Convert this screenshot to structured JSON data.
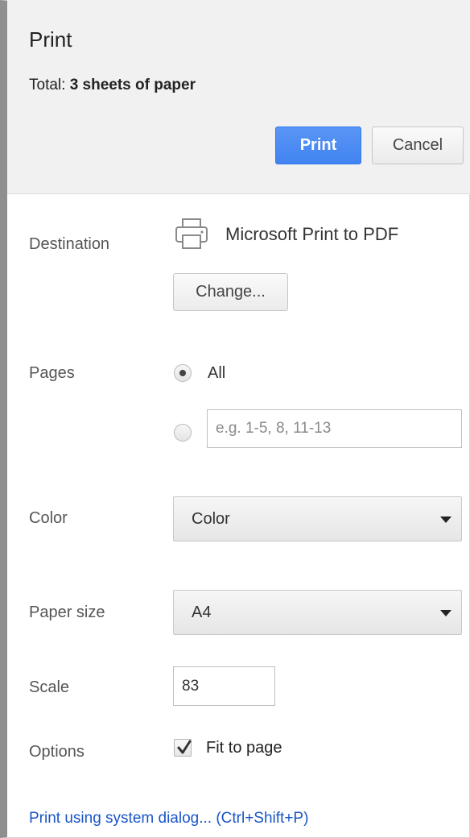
{
  "header": {
    "title": "Print",
    "total_prefix": "Total:",
    "total_value": "3 sheets of paper",
    "print_button": "Print",
    "cancel_button": "Cancel"
  },
  "destination": {
    "label": "Destination",
    "printer_name": "Microsoft Print to PDF",
    "printer_icon": "printer-icon",
    "change_button": "Change..."
  },
  "pages": {
    "label": "Pages",
    "option_all": "All",
    "selected": "all",
    "custom_placeholder": "e.g. 1-5, 8, 11-13",
    "custom_value": ""
  },
  "color": {
    "label": "Color",
    "selected": "Color"
  },
  "paper_size": {
    "label": "Paper size",
    "selected": "A4"
  },
  "scale": {
    "label": "Scale",
    "value": "83"
  },
  "options": {
    "label": "Options",
    "fit_to_page": "Fit to page",
    "fit_to_page_checked": true
  },
  "footer": {
    "system_dialog_link": "Print using system dialog... (Ctrl+Shift+P)"
  },
  "colors": {
    "primary_button": "#4285f4",
    "link": "#1a56c8",
    "header_bg": "#f1f1f1"
  }
}
